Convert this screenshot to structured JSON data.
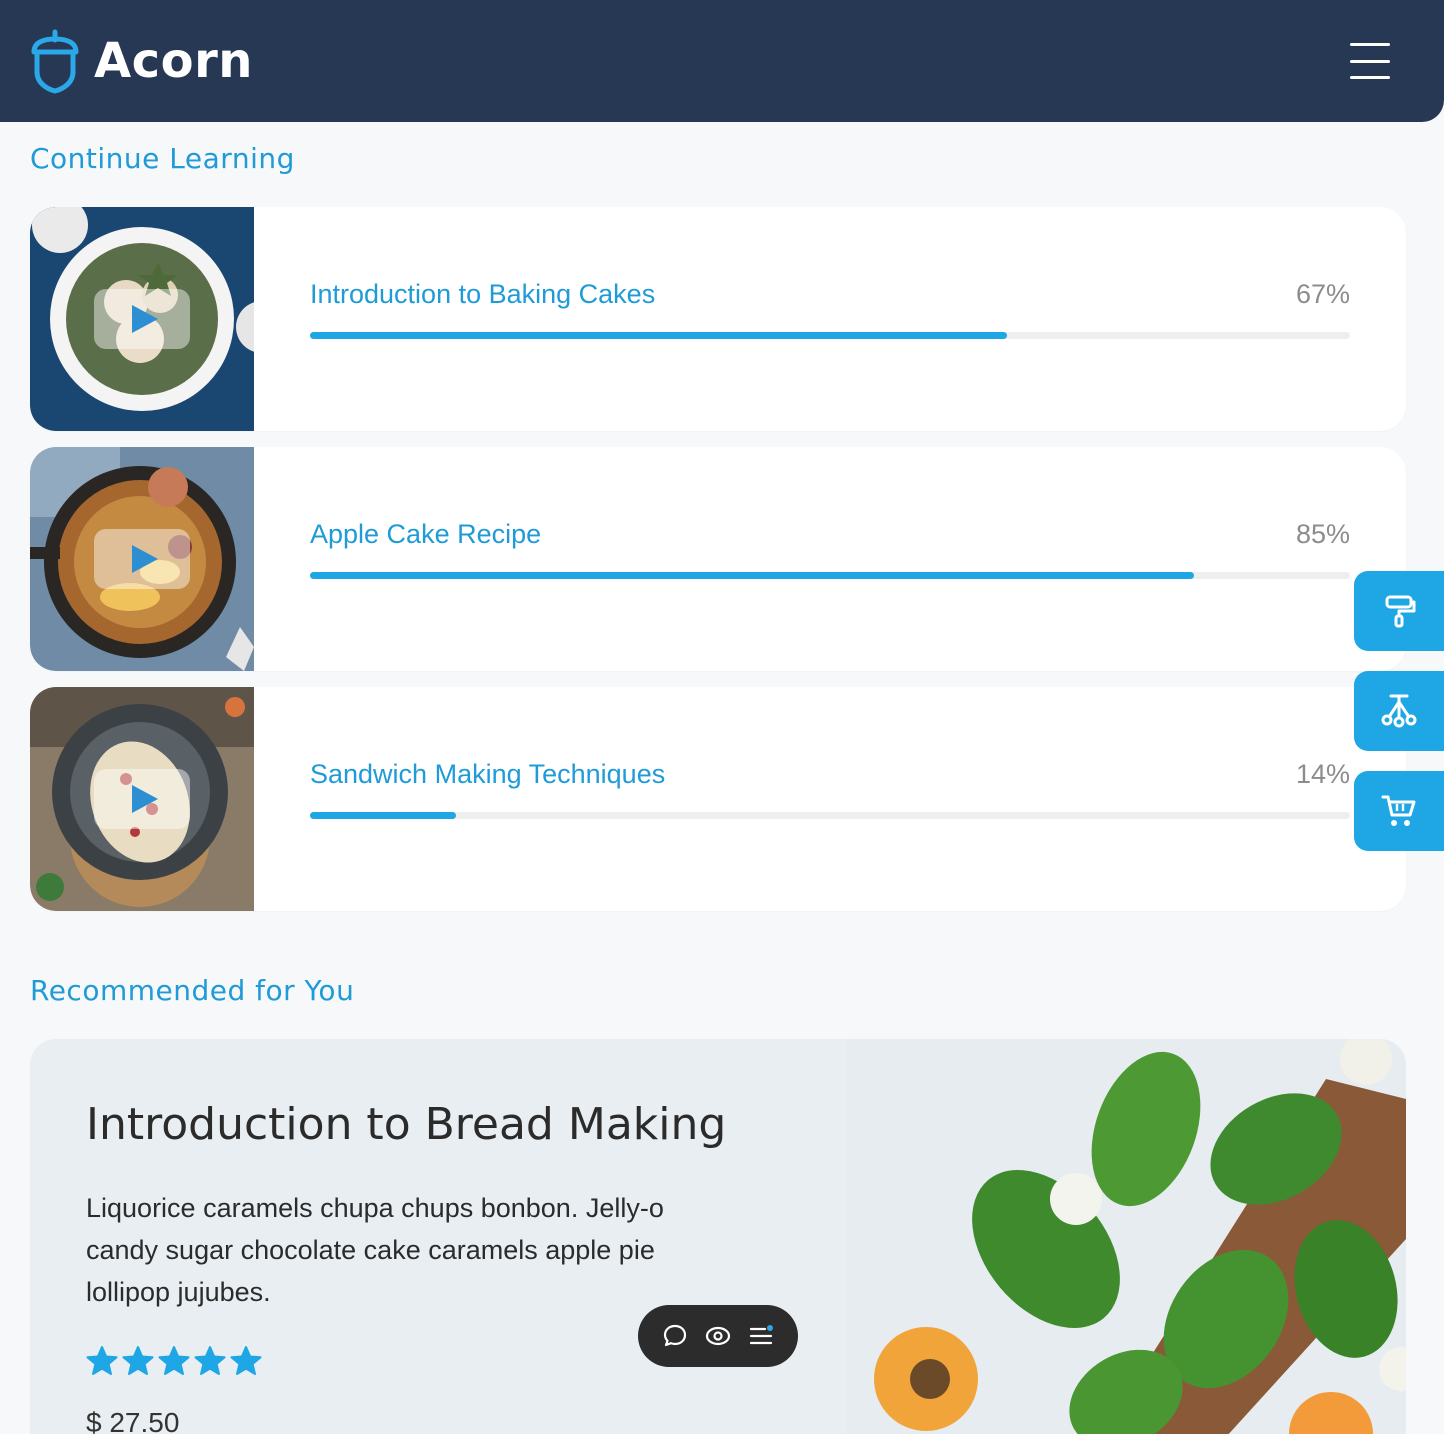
{
  "header": {
    "brand_name": "Acorn"
  },
  "continue_learning": {
    "title": "Continue Learning",
    "courses": [
      {
        "name": "Introduction to Baking Cakes",
        "progress_label": "67%",
        "progress": 0.67
      },
      {
        "name": "Apple Cake Recipe",
        "progress_label": "85%",
        "progress": 0.85
      },
      {
        "name": "Sandwich Making Techniques",
        "progress_label": "14%",
        "progress": 0.14
      }
    ]
  },
  "recommended": {
    "title": "Recommended for You",
    "card": {
      "title": "Introduction to Bread Making",
      "description": "Liquorice caramels chupa chups bonbon. Jelly-o candy sugar chocolate cake caramels apple pie lollipop jujubes.",
      "rating": 5,
      "price": "$ 27.50"
    }
  },
  "side_tools": [
    "paint-roller-icon",
    "flow-icon",
    "cart-icon"
  ],
  "floating_toolbar": [
    "chat-bubble-icon",
    "eye-icon",
    "list-icon"
  ],
  "colors": {
    "header_bg": "#263853",
    "accent": "#1ea7e4",
    "title_blue": "#1f9bd7",
    "star": "#1ea7e4"
  }
}
